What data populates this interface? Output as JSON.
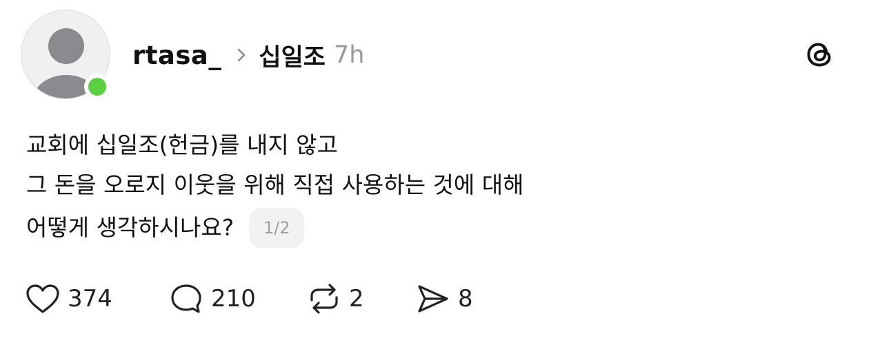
{
  "post": {
    "author": "rtasa_",
    "community": "십일조",
    "time": "7h",
    "lines": [
      "교회에 십일조(헌금)를 내지 않고",
      "그 돈을 오로지 이웃을 위해 직접 사용하는 것에 대해",
      "어떻게 생각하시나요?"
    ],
    "page_indicator": "1/2",
    "online_status_color": "#5ad141",
    "header_chevron_icon": "chevron-right-icon",
    "app_icon": "threads-logo-icon"
  },
  "actions": {
    "likes": {
      "icon": "heart-icon",
      "count": "374"
    },
    "replies": {
      "icon": "comment-icon",
      "count": "210"
    },
    "reposts": {
      "icon": "repost-icon",
      "count": "2"
    },
    "shares": {
      "icon": "send-icon",
      "count": "8"
    }
  }
}
